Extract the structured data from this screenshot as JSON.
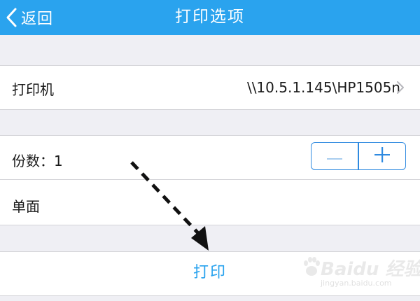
{
  "nav": {
    "back_label": "返回",
    "title": "打印选项"
  },
  "printer": {
    "label": "打印机",
    "value": "\\\\10.5.1.145\\HP1505n"
  },
  "copies": {
    "label": "份数：1"
  },
  "duplex": {
    "label": "单面"
  },
  "print_button": {
    "label": "打印"
  },
  "watermark": {
    "brand": "Baidu 经验",
    "url": "jingyan.baidu.com"
  },
  "colors": {
    "nav_bar": "#2aa3ee",
    "accent": "#2f8ae0",
    "background": "#efeff4"
  }
}
